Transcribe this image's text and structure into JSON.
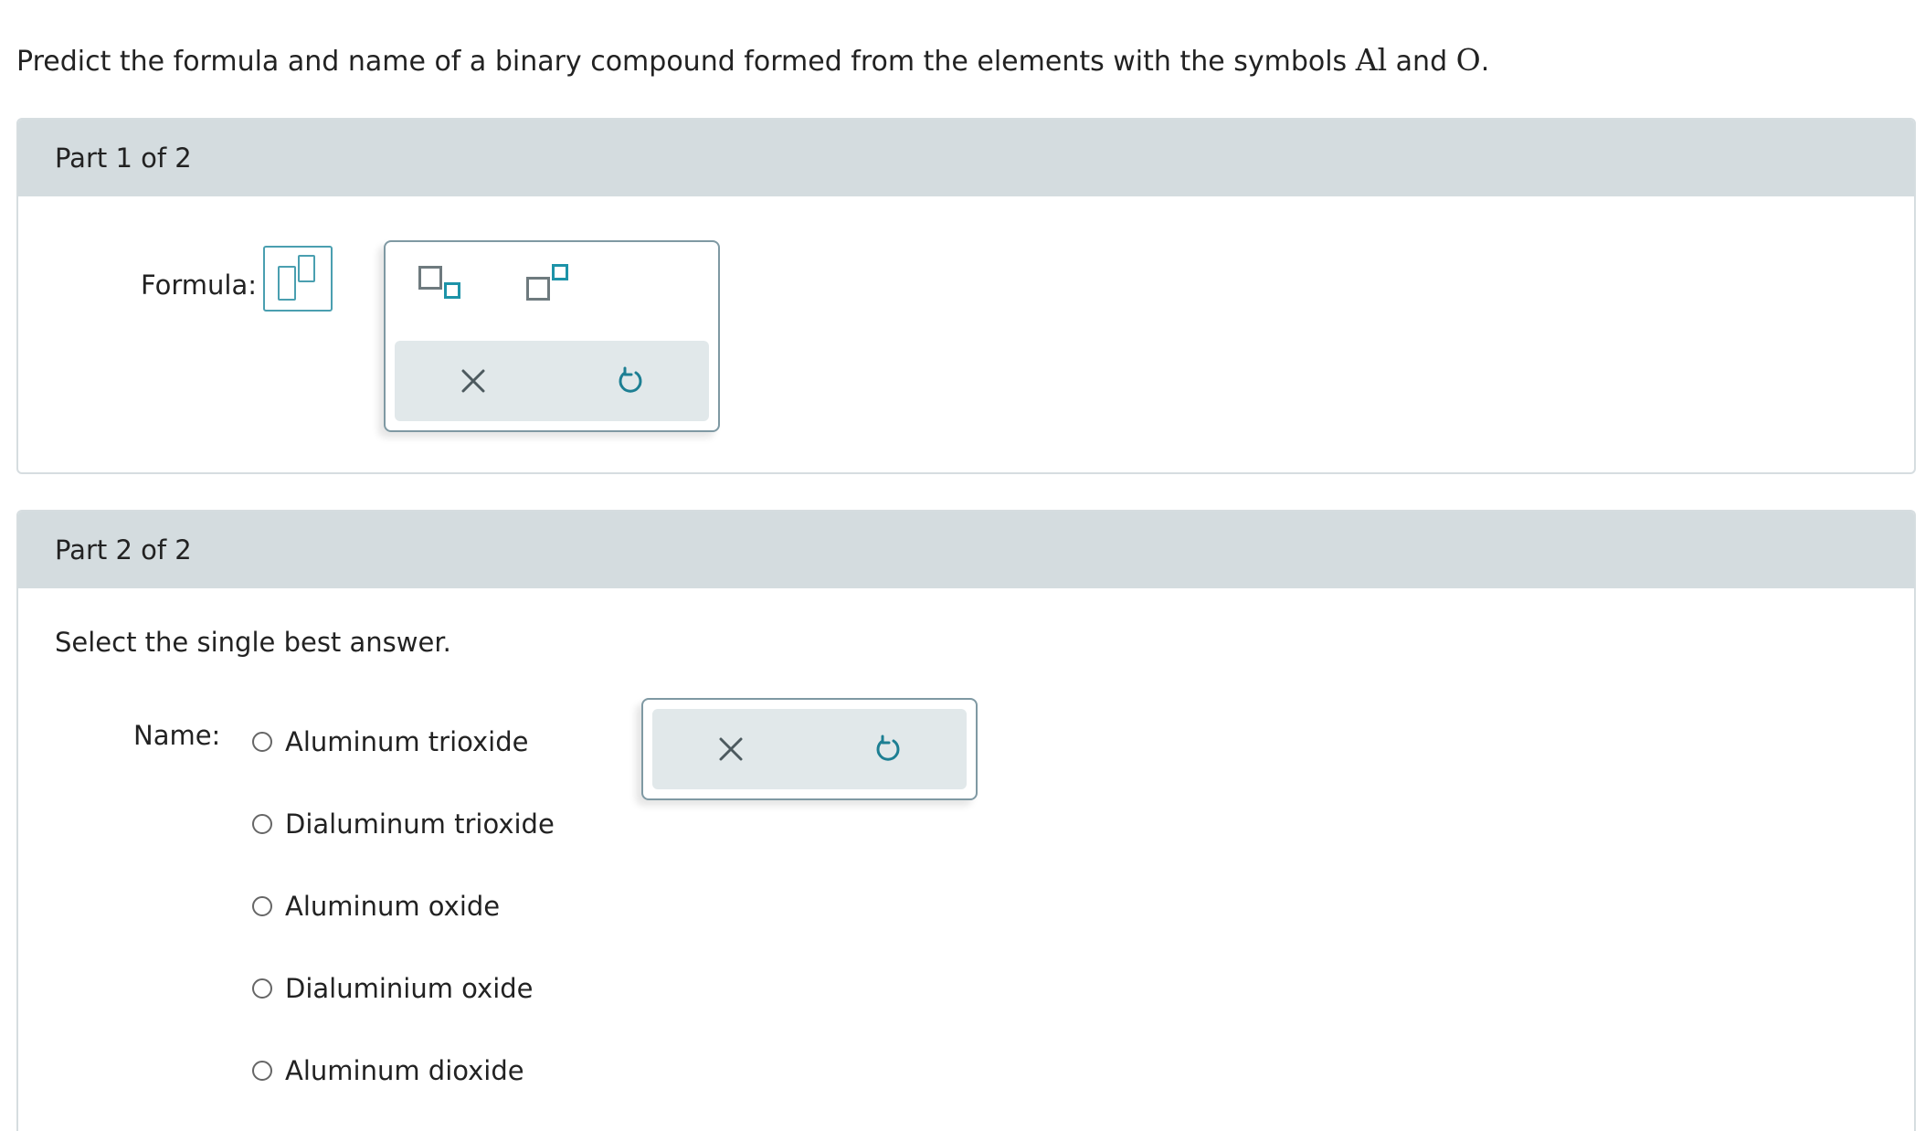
{
  "question": {
    "prefix": "Predict the formula and name of a binary compound formed from the elements with the symbols",
    "symbol1": "Al",
    "connector": "and",
    "symbol2": "O",
    "suffix": "."
  },
  "part1": {
    "header": "Part 1 of 2",
    "formula_label": "Formula:"
  },
  "part2": {
    "header": "Part 2 of 2",
    "instruction": "Select the single best answer.",
    "name_label": "Name:",
    "options": [
      {
        "label": "Aluminum trioxide"
      },
      {
        "label": "Dialuminum trioxide"
      },
      {
        "label": "Aluminum oxide"
      },
      {
        "label": "Dialuminium oxide"
      },
      {
        "label": "Aluminum dioxide"
      }
    ]
  },
  "icons": {
    "subscript": "subscript-icon",
    "superscript": "superscript-icon",
    "clear": "close-icon",
    "reset": "undo-icon"
  },
  "colors": {
    "accent": "#1d93a8",
    "header_bg": "#d4dcdf",
    "action_bg": "#e1e8ea"
  }
}
